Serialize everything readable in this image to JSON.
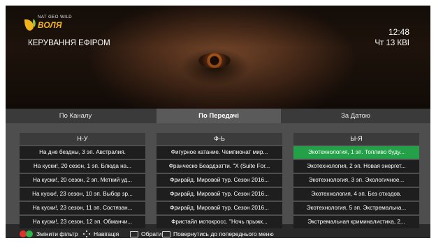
{
  "header": {
    "logo_small": "NAT GEO WILD",
    "logo_brand": "ВОЛЯ",
    "title": "КЕРУВАННЯ ЕФІРОМ",
    "time": "12:48",
    "date": "Чт 13 КВІ"
  },
  "tabs": [
    {
      "label": "По Каналу",
      "active": false
    },
    {
      "label": "По Передачі",
      "active": true
    },
    {
      "label": "За Датою",
      "active": false
    }
  ],
  "columns": [
    {
      "header": "Н-У",
      "items": [
        "На дне бездны, 3 эп. Австралия.",
        "На куски!, 20 сезон, 1 эп. Блюда на...",
        "На куски!, 20 сезон, 2 эп. Меткий уд...",
        "На куски!, 23 сезон, 10 эп. Выбор зр...",
        "На куски!, 23 сезон, 11 эп. Состязан...",
        "На куски!, 23 сезон, 12 эп. Обманчи..."
      ]
    },
    {
      "header": "Ф-Ь",
      "items": [
        "Фигурное катание. Чемпионат мир...",
        "Франческо Беардзатти. \"X (Suite For...",
        "Фрирайд. Мировой тур. Сезон 2016...",
        "Фрирайд. Мировой тур. Сезон 2016...",
        "Фрирайд. Мировой тур. Сезон 2016...",
        "Фристайл мотокросс. \"Ночь прыжк..."
      ]
    },
    {
      "header": "Ы-Я",
      "selected_index": 0,
      "items": [
        "Экотехнология, 1 эп. Топливо буду...",
        "Экотехнология, 2 эп. Новая энергет...",
        "Экотехнология, 3 эп. Экологичное...",
        "Экотехнология, 4 эп. Без отходов.",
        "Экотехнология, 5 эп. Экстремальна...",
        "Экстремальная криминалистика, 2..."
      ]
    }
  ],
  "footer": {
    "filter": "Змінити фільтр",
    "navigation": "Навігація",
    "select": "Обрати",
    "back": "Повернутись до попереднього меню"
  },
  "colors": {
    "selected": "#24a049",
    "red_key": "#e2302b",
    "green_key": "#2fb34a",
    "logo": "#f1b41c"
  }
}
